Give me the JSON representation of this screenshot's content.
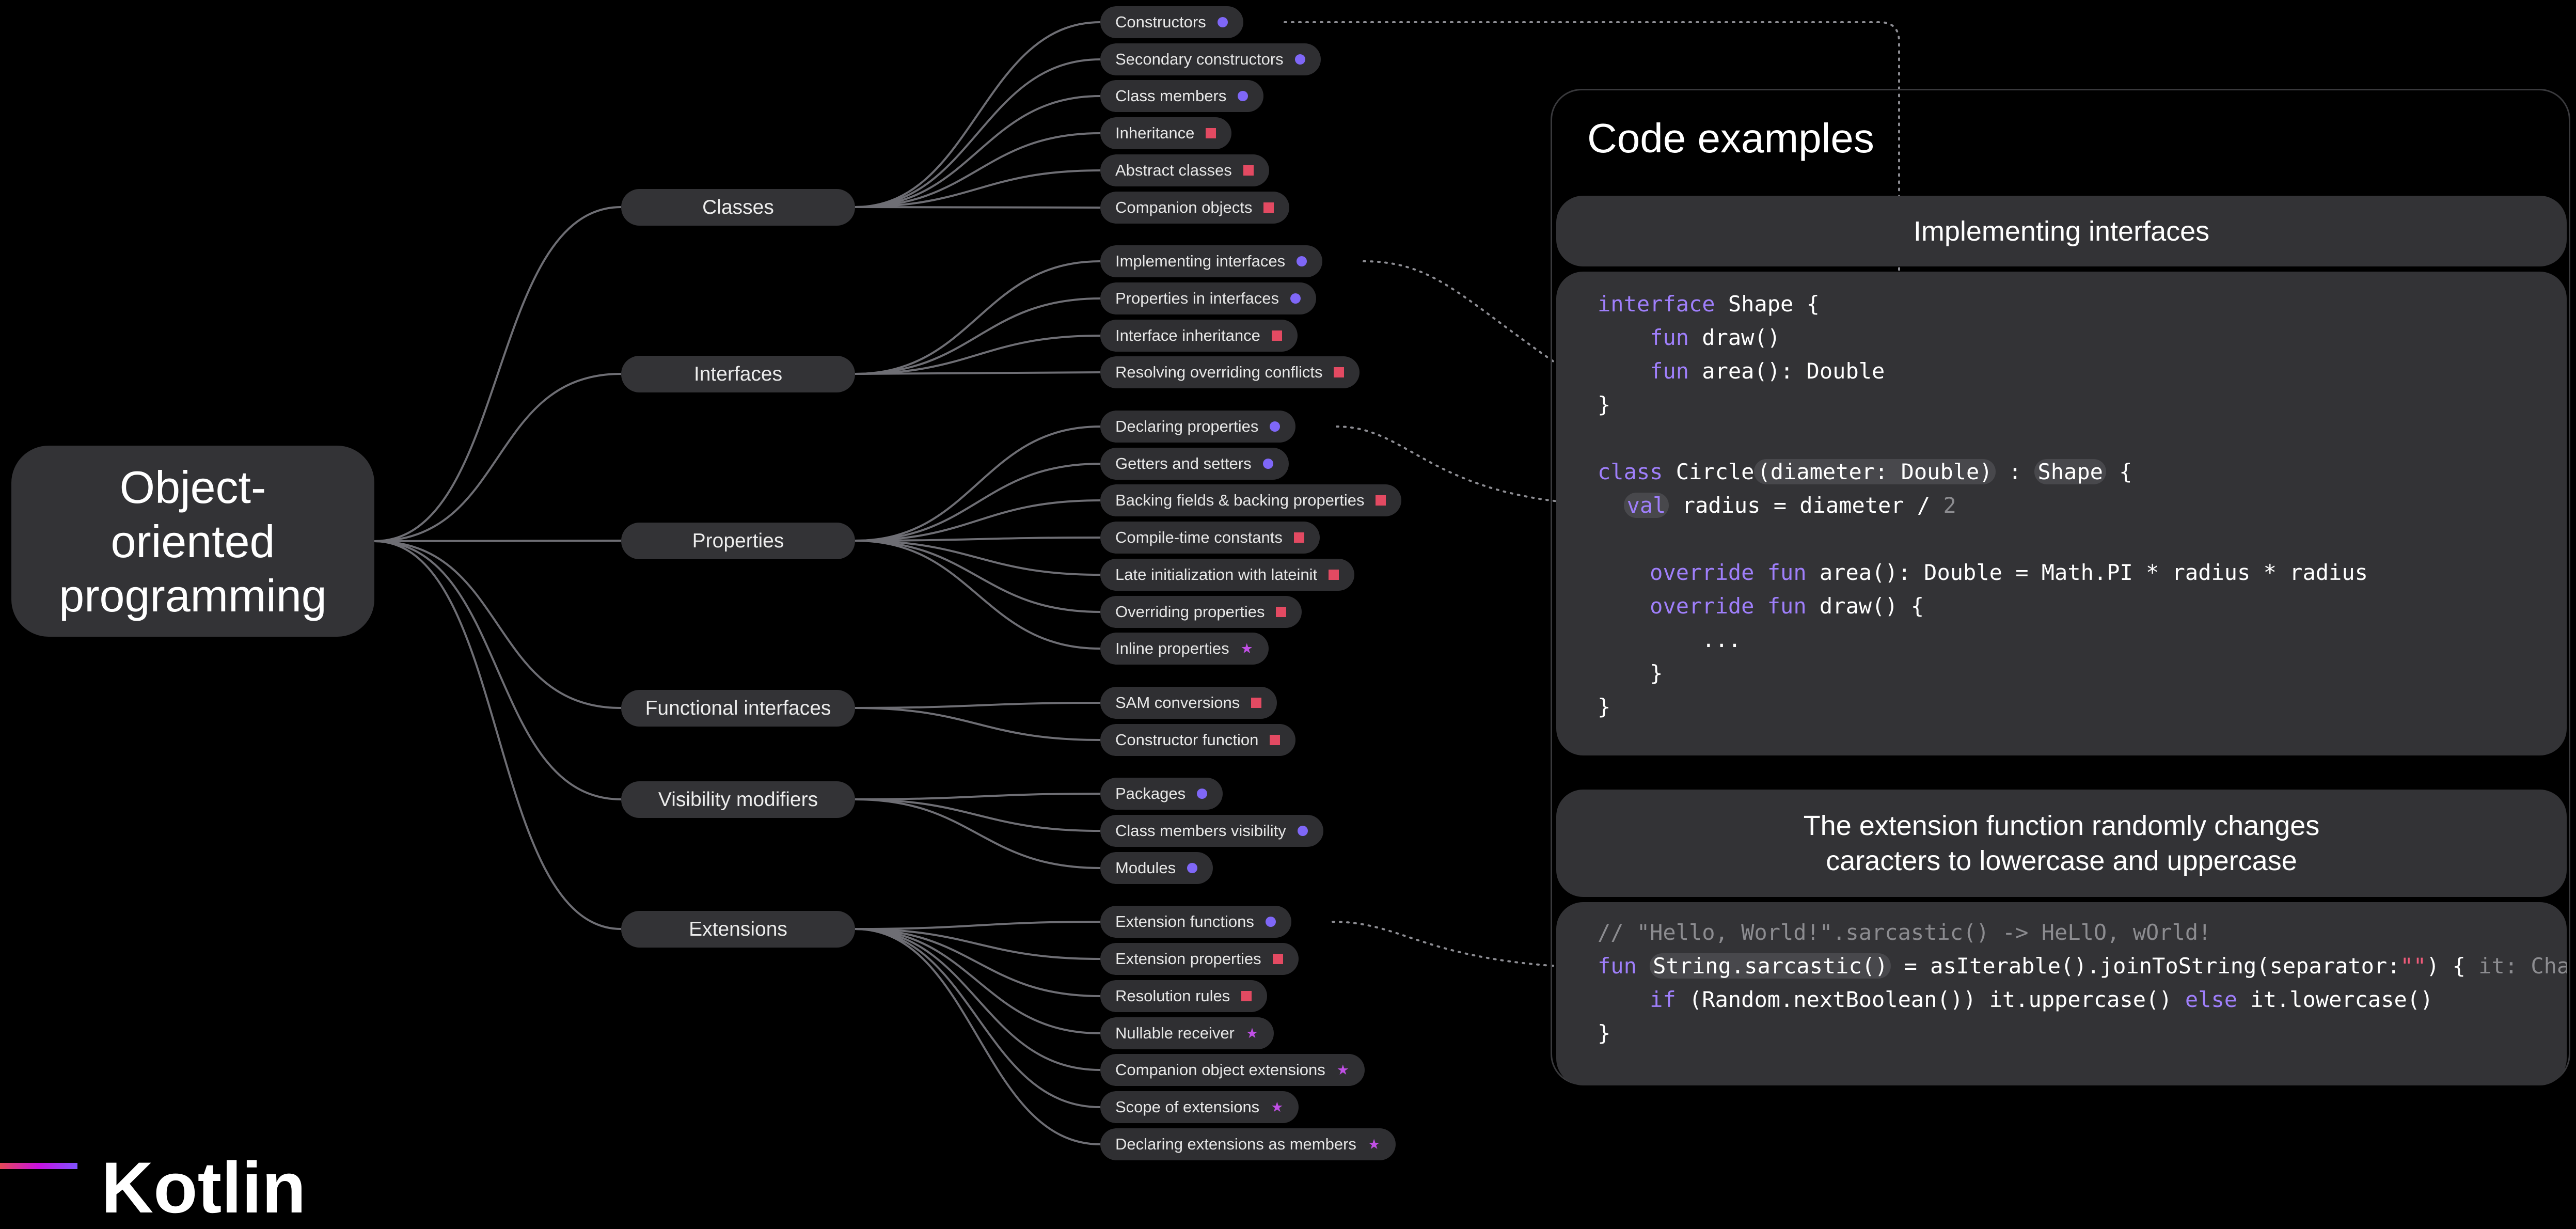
{
  "root": {
    "label": "Object-\noriented\nprogramming"
  },
  "categories": [
    {
      "label": "Classes",
      "topics": [
        {
          "label": "Constructors",
          "marker": "circle"
        },
        {
          "label": "Secondary constructors",
          "marker": "circle"
        },
        {
          "label": "Class members",
          "marker": "circle"
        },
        {
          "label": "Inheritance",
          "marker": "square"
        },
        {
          "label": "Abstract classes",
          "marker": "square"
        },
        {
          "label": "Companion objects",
          "marker": "square"
        }
      ]
    },
    {
      "label": "Interfaces",
      "topics": [
        {
          "label": "Implementing interfaces",
          "marker": "circle"
        },
        {
          "label": "Properties in interfaces",
          "marker": "circle"
        },
        {
          "label": "Interface inheritance",
          "marker": "square"
        },
        {
          "label": "Resolving overriding conflicts",
          "marker": "square"
        }
      ]
    },
    {
      "label": "Properties",
      "topics": [
        {
          "label": "Declaring properties",
          "marker": "circle"
        },
        {
          "label": "Getters and setters",
          "marker": "circle"
        },
        {
          "label": "Backing fields & backing properties",
          "marker": "square"
        },
        {
          "label": "Compile-time constants",
          "marker": "square"
        },
        {
          "label": "Late initialization with lateinit",
          "marker": "square"
        },
        {
          "label": "Overriding properties",
          "marker": "square"
        },
        {
          "label": "Inline properties",
          "marker": "star"
        }
      ]
    },
    {
      "label": "Functional interfaces",
      "topics": [
        {
          "label": "SAM conversions",
          "marker": "square"
        },
        {
          "label": "Constructor function",
          "marker": "square"
        }
      ]
    },
    {
      "label": "Visibility modifiers",
      "topics": [
        {
          "label": "Packages",
          "marker": "circle"
        },
        {
          "label": "Class members visibility",
          "marker": "circle"
        },
        {
          "label": "Modules",
          "marker": "circle"
        }
      ]
    },
    {
      "label": "Extensions",
      "topics": [
        {
          "label": "Extension functions",
          "marker": "circle"
        },
        {
          "label": "Extension properties",
          "marker": "square"
        },
        {
          "label": "Resolution rules",
          "marker": "square"
        },
        {
          "label": "Nullable receiver",
          "marker": "star"
        },
        {
          "label": "Companion object extensions",
          "marker": "star"
        },
        {
          "label": "Scope of extensions",
          "marker": "star"
        },
        {
          "label": "Declaring extensions as members",
          "marker": "star"
        }
      ]
    }
  ],
  "markers": {
    "circle": "#7f67f7",
    "square": "#e34a62",
    "star": "#c04fe5",
    "star_glyph": "★"
  },
  "code_panel": {
    "title": "Code examples",
    "example1": {
      "heading": "Implementing interfaces",
      "lines": [
        [
          {
            "t": "interface",
            "c": "kw"
          },
          {
            "t": " Shape {"
          }
        ],
        [
          {
            "t": "    "
          },
          {
            "t": "fun",
            "c": "kw"
          },
          {
            "t": " draw()"
          }
        ],
        [
          {
            "t": "    "
          },
          {
            "t": "fun",
            "c": "kw"
          },
          {
            "t": " area(): Double"
          }
        ],
        [
          {
            "t": "}"
          }
        ],
        [],
        [
          {
            "t": "class",
            "c": "kw"
          },
          {
            "t": " Circle"
          },
          {
            "t": "(diameter: Double)",
            "c": "hl"
          },
          {
            "t": " : "
          },
          {
            "t": "Shape",
            "c": "hl"
          },
          {
            "t": " {"
          }
        ],
        [
          {
            "t": "  "
          },
          {
            "t": "val",
            "c": "kw hl"
          },
          {
            "t": " radius = diameter / "
          },
          {
            "t": "2",
            "c": "cm"
          }
        ],
        [],
        [
          {
            "t": "    "
          },
          {
            "t": "override",
            "c": "kw"
          },
          {
            "t": " "
          },
          {
            "t": "fun",
            "c": "kw"
          },
          {
            "t": " area(): Double = Math.PI * radius * radius"
          }
        ],
        [
          {
            "t": "    "
          },
          {
            "t": "override",
            "c": "kw"
          },
          {
            "t": " "
          },
          {
            "t": "fun",
            "c": "kw"
          },
          {
            "t": " draw() {"
          }
        ],
        [
          {
            "t": "        ..."
          }
        ],
        [
          {
            "t": "    }"
          }
        ],
        [
          {
            "t": "}"
          }
        ]
      ]
    },
    "example2": {
      "heading": "The extension function randomly changes\ncaracters to lowercase and uppercase",
      "lines": [
        [
          {
            "t": "// \"Hello, World!\".sarcastic() -> HeLlO, wOrld!",
            "c": "cm"
          }
        ],
        [
          {
            "t": "fun",
            "c": "kw"
          },
          {
            "t": " "
          },
          {
            "t": "String.sarcastic()",
            "c": "hl"
          },
          {
            "t": " = asIterable().joinToString(separator:"
          },
          {
            "t": "\"\"",
            "c": "str"
          },
          {
            "t": ") { "
          },
          {
            "t": "it: Char",
            "c": "cm"
          }
        ],
        [
          {
            "t": "    "
          },
          {
            "t": "if",
            "c": "kw"
          },
          {
            "t": " (Random.nextBoolean()) it.uppercase() "
          },
          {
            "t": "else",
            "c": "kw"
          },
          {
            "t": " it.lowercase()"
          }
        ],
        [
          {
            "t": "}"
          }
        ]
      ]
    }
  },
  "logo": {
    "text": "Kotlin"
  }
}
